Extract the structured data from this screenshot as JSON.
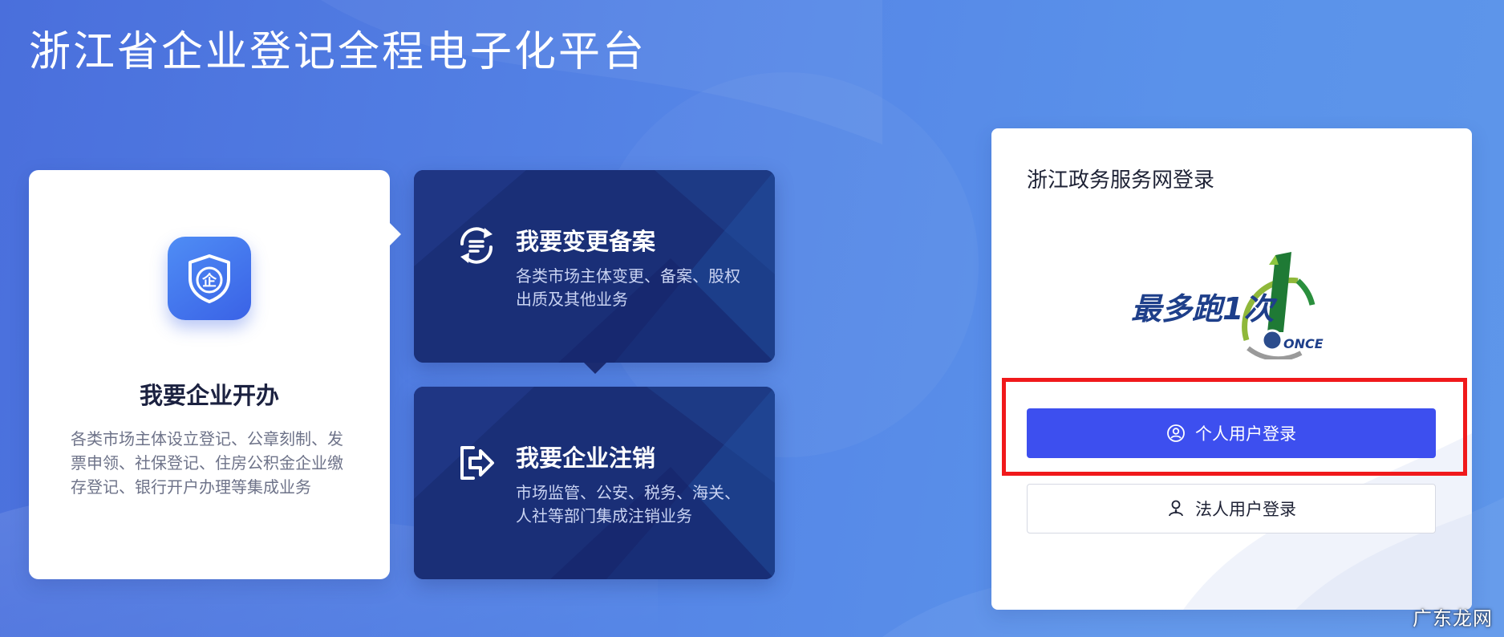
{
  "page": {
    "title": "浙江省企业登记全程电子化平台"
  },
  "cards": {
    "open": {
      "badge_char": "企",
      "title": "我要企业开办",
      "desc": "各类市场主体设立登记、公章刻制、发票申领、社保登记、住房公积金企业缴存登记、银行开户办理等集成业务"
    },
    "change": {
      "title": "我要变更备案",
      "desc": "各类市场主体变更、备案、股权出质及其他业务"
    },
    "cancel": {
      "title": "我要企业注销",
      "desc": "市场监管、公安、税务、海关、人社等部门集成注销业务"
    }
  },
  "login": {
    "title": "浙江政务服务网登录",
    "logo_text": "最多跑1次",
    "logo_sub": "ONCE",
    "personal_label": "个人用户登录",
    "legal_label": "法人用户登录"
  },
  "watermark": "广东龙网",
  "colors": {
    "primary_button": "#3d4fef",
    "highlight_border": "#f0191b",
    "dark_card": "#1a2f77"
  }
}
